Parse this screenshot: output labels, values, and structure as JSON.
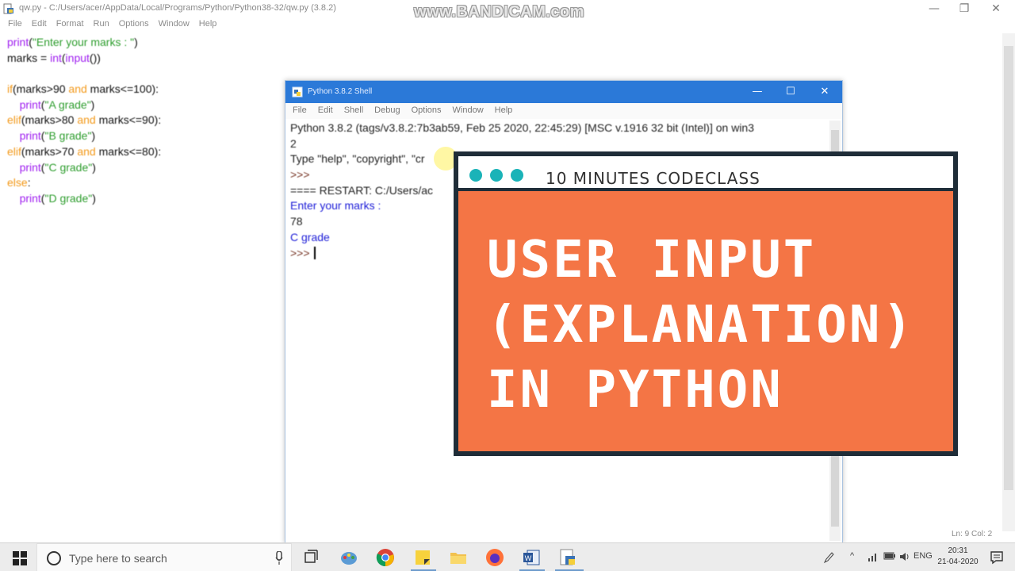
{
  "editor": {
    "title": "qw.py - C:/Users/acer/AppData/Local/Programs/Python/Python38-32/qw.py (3.8.2)",
    "menus": [
      "File",
      "Edit",
      "Format",
      "Run",
      "Options",
      "Window",
      "Help"
    ],
    "window_buttons": {
      "minimize": "—",
      "maximize": "❐",
      "close": "✕"
    },
    "code": [
      [
        {
          "t": "print",
          "c": "kw-purple"
        },
        {
          "t": "(",
          "c": "plain"
        },
        {
          "t": "\"Enter your marks : \"",
          "c": "str-green"
        },
        {
          "t": ")",
          "c": "plain"
        }
      ],
      [
        {
          "t": "marks = ",
          "c": "plain"
        },
        {
          "t": "int",
          "c": "kw-purple"
        },
        {
          "t": "(",
          "c": "plain"
        },
        {
          "t": "input",
          "c": "kw-purple"
        },
        {
          "t": "())",
          "c": "plain"
        }
      ],
      [],
      [
        {
          "t": "if",
          "c": "kw-orange"
        },
        {
          "t": "(marks>90 ",
          "c": "plain"
        },
        {
          "t": "and",
          "c": "kw-orange"
        },
        {
          "t": " marks<=100):",
          "c": "plain"
        }
      ],
      [
        {
          "t": "    ",
          "c": "plain"
        },
        {
          "t": "print",
          "c": "kw-purple"
        },
        {
          "t": "(",
          "c": "plain"
        },
        {
          "t": "\"A grade\"",
          "c": "str-green"
        },
        {
          "t": ")",
          "c": "plain"
        }
      ],
      [
        {
          "t": "elif",
          "c": "kw-orange"
        },
        {
          "t": "(marks>80 ",
          "c": "plain"
        },
        {
          "t": "and",
          "c": "kw-orange"
        },
        {
          "t": " marks<=90):",
          "c": "plain"
        }
      ],
      [
        {
          "t": "    ",
          "c": "plain"
        },
        {
          "t": "print",
          "c": "kw-purple"
        },
        {
          "t": "(",
          "c": "plain"
        },
        {
          "t": "\"B grade\"",
          "c": "str-green"
        },
        {
          "t": ")",
          "c": "plain"
        }
      ],
      [
        {
          "t": "elif",
          "c": "kw-orange"
        },
        {
          "t": "(marks>70 ",
          "c": "plain"
        },
        {
          "t": "and",
          "c": "kw-orange"
        },
        {
          "t": " marks<=80):",
          "c": "plain"
        }
      ],
      [
        {
          "t": "    ",
          "c": "plain"
        },
        {
          "t": "print",
          "c": "kw-purple"
        },
        {
          "t": "(",
          "c": "plain"
        },
        {
          "t": "\"C grade\"",
          "c": "str-green"
        },
        {
          "t": ")",
          "c": "plain"
        }
      ],
      [
        {
          "t": "else",
          "c": "kw-orange"
        },
        {
          "t": ":",
          "c": "plain"
        }
      ],
      [
        {
          "t": "    ",
          "c": "plain"
        },
        {
          "t": "print",
          "c": "kw-purple"
        },
        {
          "t": "(",
          "c": "plain"
        },
        {
          "t": "\"D grade\"",
          "c": "str-green"
        },
        {
          "t": ")",
          "c": "plain"
        }
      ]
    ],
    "status": "Ln: 9   Col: 2"
  },
  "watermark": "www.BANDICAM.com",
  "shell": {
    "title": "Python 3.8.2 Shell",
    "menus": [
      "File",
      "Edit",
      "Shell",
      "Debug",
      "Options",
      "Window",
      "Help"
    ],
    "window_buttons": {
      "minimize": "—",
      "maximize": "☐",
      "close": "✕"
    },
    "output": [
      {
        "t": "Python 3.8.2 (tags/v3.8.2:7b3ab59, Feb 25 2020, 22:45:29) [MSC v.1916 32 bit (Intel)] on win3",
        "c": "out-black"
      },
      {
        "t": "2",
        "c": "out-black"
      },
      {
        "t": "Type \"help\", \"copyright\", \"cr",
        "c": "out-black"
      },
      {
        "t": ">>> ",
        "c": "out-prompt"
      },
      {
        "t": "==== RESTART: C:/Users/ac",
        "c": "out-black"
      },
      {
        "t": "Enter your marks : ",
        "c": "out-blue"
      },
      {
        "t": "78",
        "c": "out-black"
      },
      {
        "t": "C grade",
        "c": "out-blue"
      },
      {
        "t": ">>> ",
        "c": "out-prompt"
      }
    ]
  },
  "overlay": {
    "brand": "10 MINUTES CODECLASS",
    "title": "USER INPUT\n(EXPLANATION)\nIN PYTHON",
    "accent_color": "#f47545",
    "dot_color": "#1ab3b8"
  },
  "taskbar": {
    "search_placeholder": "Type here to search",
    "language": "ENG",
    "time": "20:31",
    "date": "21-04-2020",
    "apps": [
      "task-view-icon",
      "paint-icon",
      "chrome-icon",
      "sticky-notes-icon",
      "file-explorer-icon",
      "firefox-icon",
      "word-icon",
      "python-idle-icon"
    ]
  }
}
